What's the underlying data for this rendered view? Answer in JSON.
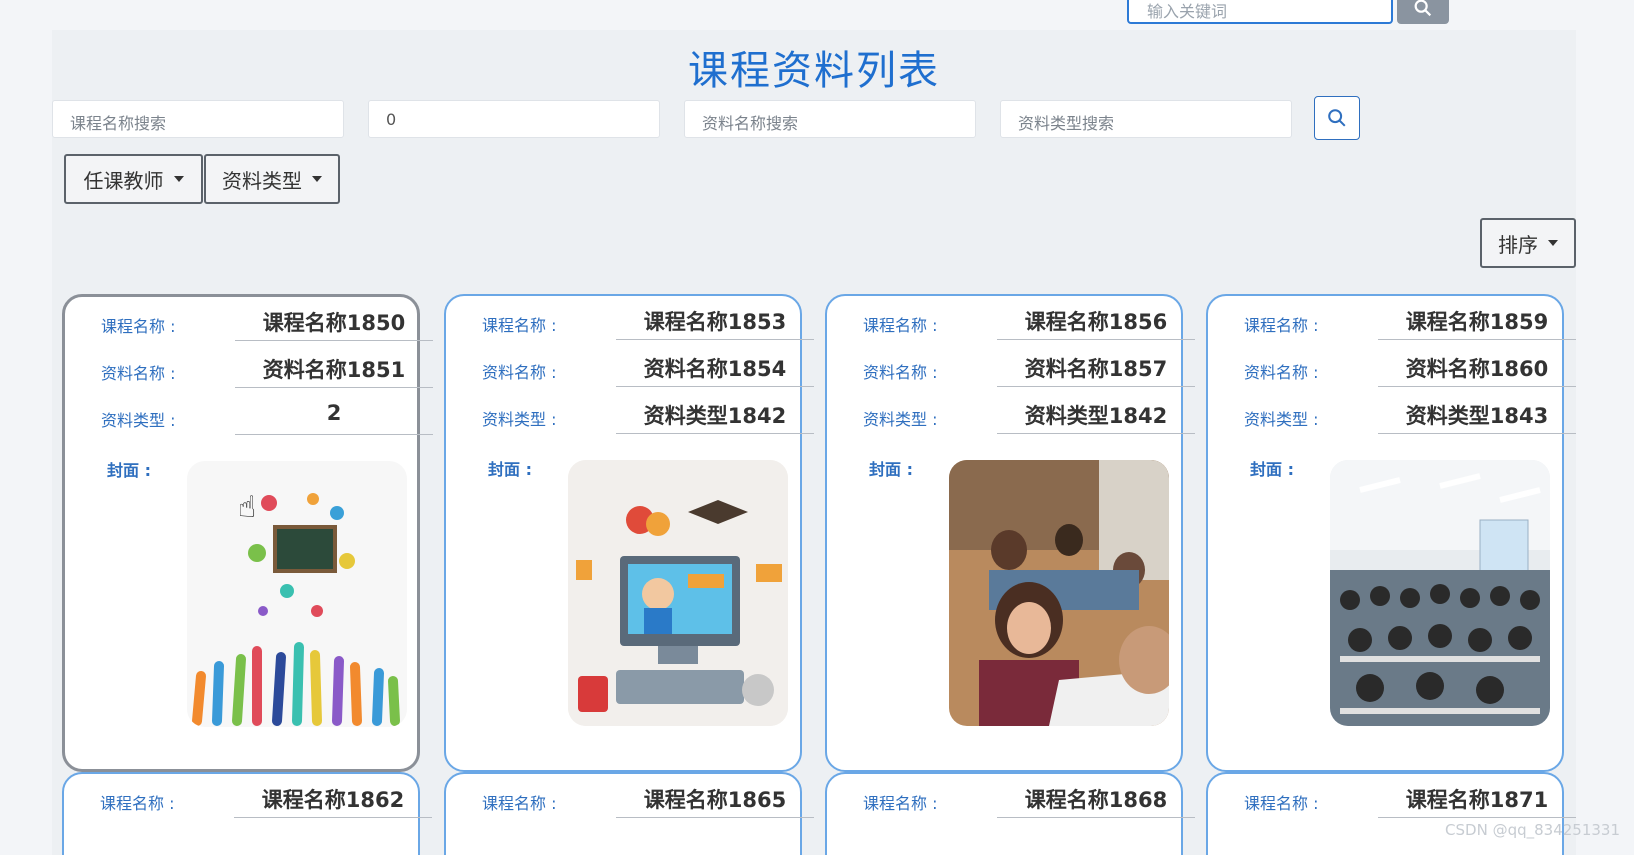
{
  "top_search": {
    "placeholder": "输入关键词"
  },
  "page_title": "课程资料列表",
  "filters": {
    "course_name_placeholder": "课程名称搜索",
    "number_value": "0",
    "material_name_placeholder": "资料名称搜索",
    "material_type_placeholder": "资料类型搜索"
  },
  "dropdowns": {
    "teacher": "任课教师",
    "type": "资料类型",
    "sort": "排序"
  },
  "labels": {
    "course": "课程名称 :",
    "material": "资料名称 :",
    "type": "资料类型 :",
    "cover": "封面 :"
  },
  "cards": [
    {
      "course": "课程名称1850",
      "material": "资料名称1851",
      "type": "2",
      "cover": "school-illustration"
    },
    {
      "course": "课程名称1853",
      "material": "资料名称1854",
      "type": "资料类型1842",
      "cover": "online-class-illustration"
    },
    {
      "course": "课程名称1856",
      "material": "资料名称1857",
      "type": "资料类型1842",
      "cover": "classroom-photo"
    },
    {
      "course": "课程名称1859",
      "material": "资料名称1860",
      "type": "资料类型1843",
      "cover": "lecture-hall-photo"
    },
    {
      "course": "课程名称1862"
    },
    {
      "course": "课程名称1865"
    },
    {
      "course": "课程名称1868"
    },
    {
      "course": "课程名称1871"
    }
  ],
  "watermark": "CSDN @qq_834251331"
}
